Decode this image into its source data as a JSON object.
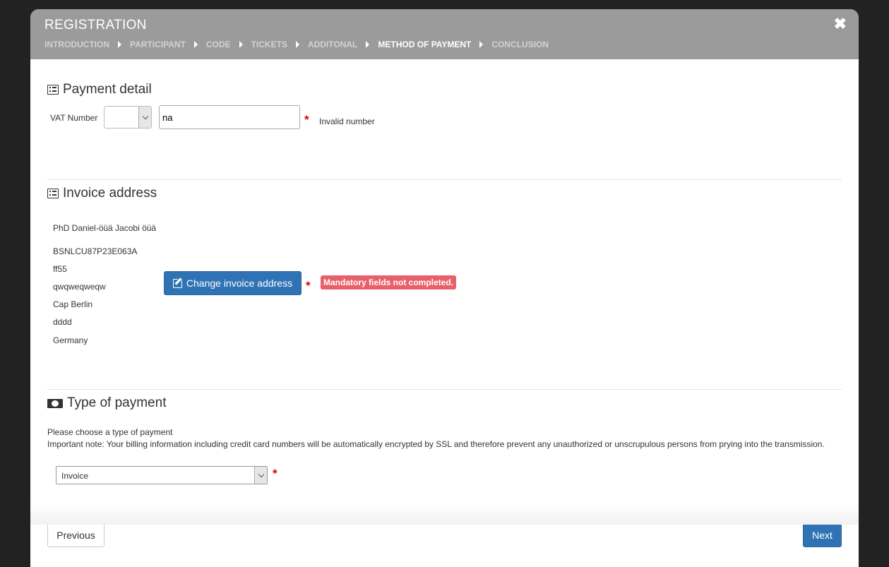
{
  "modal": {
    "title": "REGISTRATION",
    "close_icon": "close-icon",
    "steps": [
      {
        "label": "INTRODUCTION",
        "active": false
      },
      {
        "label": "PARTICIPANT",
        "active": false
      },
      {
        "label": "CODE",
        "active": false
      },
      {
        "label": "TICKETS",
        "active": false
      },
      {
        "label": "ADDITONAL",
        "active": false
      },
      {
        "label": "METHOD OF PAYMENT",
        "active": true
      },
      {
        "label": "CONCLUSION",
        "active": false
      }
    ]
  },
  "payment_detail": {
    "title": "Payment detail",
    "vat_label": "VAT Number",
    "vat_country_value": "",
    "vat_number_value": "na",
    "required_mark": "*",
    "vat_error": "Invalid number"
  },
  "invoice_address": {
    "title": "Invoice address",
    "name": "PhD Daniel-öüä Jacobi öüä",
    "lines": [
      "BSNLCU87P23E063A",
      "ff55",
      "qwqweqweqw",
      "Cap Berlin",
      "dddd",
      "Germany"
    ],
    "change_button_label": "Change invoice address",
    "required_mark": "*",
    "error_badge": "Mandatory fields not completed."
  },
  "payment_type": {
    "title": "Type of payment",
    "instruction": "Please choose a type of payment",
    "note": "Important note: Your billing information including credit card numbers will be automatically encrypted by SSL and therefore prevent any unauthorized or unscrupulous persons from prying into the transmission.",
    "selected": "Invoice",
    "required_mark": "*"
  },
  "footer": {
    "previous_label": "Previous",
    "next_label": "Next"
  },
  "colors": {
    "header_bg": "#9b9b9b",
    "primary": "#2f73b5",
    "error_badge": "#e8606a",
    "required": "#e00000"
  }
}
